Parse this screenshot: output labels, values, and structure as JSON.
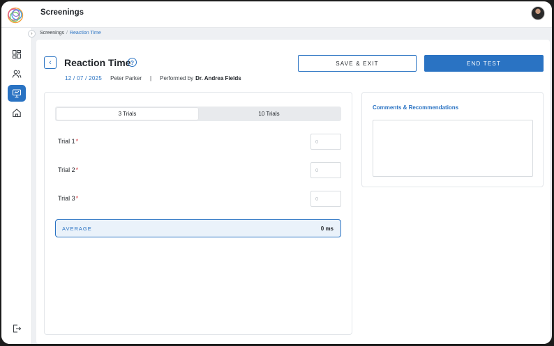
{
  "app": {
    "title": "Screenings"
  },
  "breadcrumb": {
    "root": "Screenings",
    "separator": "/",
    "current": "Reaction Time"
  },
  "test": {
    "title": "Reaction Time",
    "date": "12 / 07 / 2025",
    "patient": "Peter Parker",
    "divider": "|",
    "performed_by_label": "Performed by",
    "performer": "Dr. Andrea Fields"
  },
  "actions": {
    "save_exit": "SAVE & EXIT",
    "end_test": "END TEST"
  },
  "trials": {
    "options": [
      "3 Trials",
      "10 Trials"
    ],
    "selected": "3 Trials",
    "rows": [
      {
        "label": "Trial 1",
        "required": "*",
        "placeholder": "0"
      },
      {
        "label": "Trial 2",
        "required": "*",
        "placeholder": "0"
      },
      {
        "label": "Trial 3",
        "required": "*",
        "placeholder": "0"
      }
    ],
    "average_label": "AVERAGE",
    "average_value": "0 ms"
  },
  "comments": {
    "title": "Comments & Recommendations",
    "value": ""
  },
  "icons": {
    "sidebar": [
      "dashboard-icon",
      "users-icon",
      "screenings-icon",
      "home-icon"
    ],
    "logout": "logout-icon",
    "back": "chevron-left-icon",
    "help": "help-circle-icon",
    "collapse": "chevron-right-icon"
  },
  "glyphs": {
    "back": "‹",
    "help": "?",
    "collapse": "›"
  },
  "colors": {
    "accent": "#2a73c3",
    "required": "#d9363e",
    "average_bg": "#eaf2fa"
  }
}
